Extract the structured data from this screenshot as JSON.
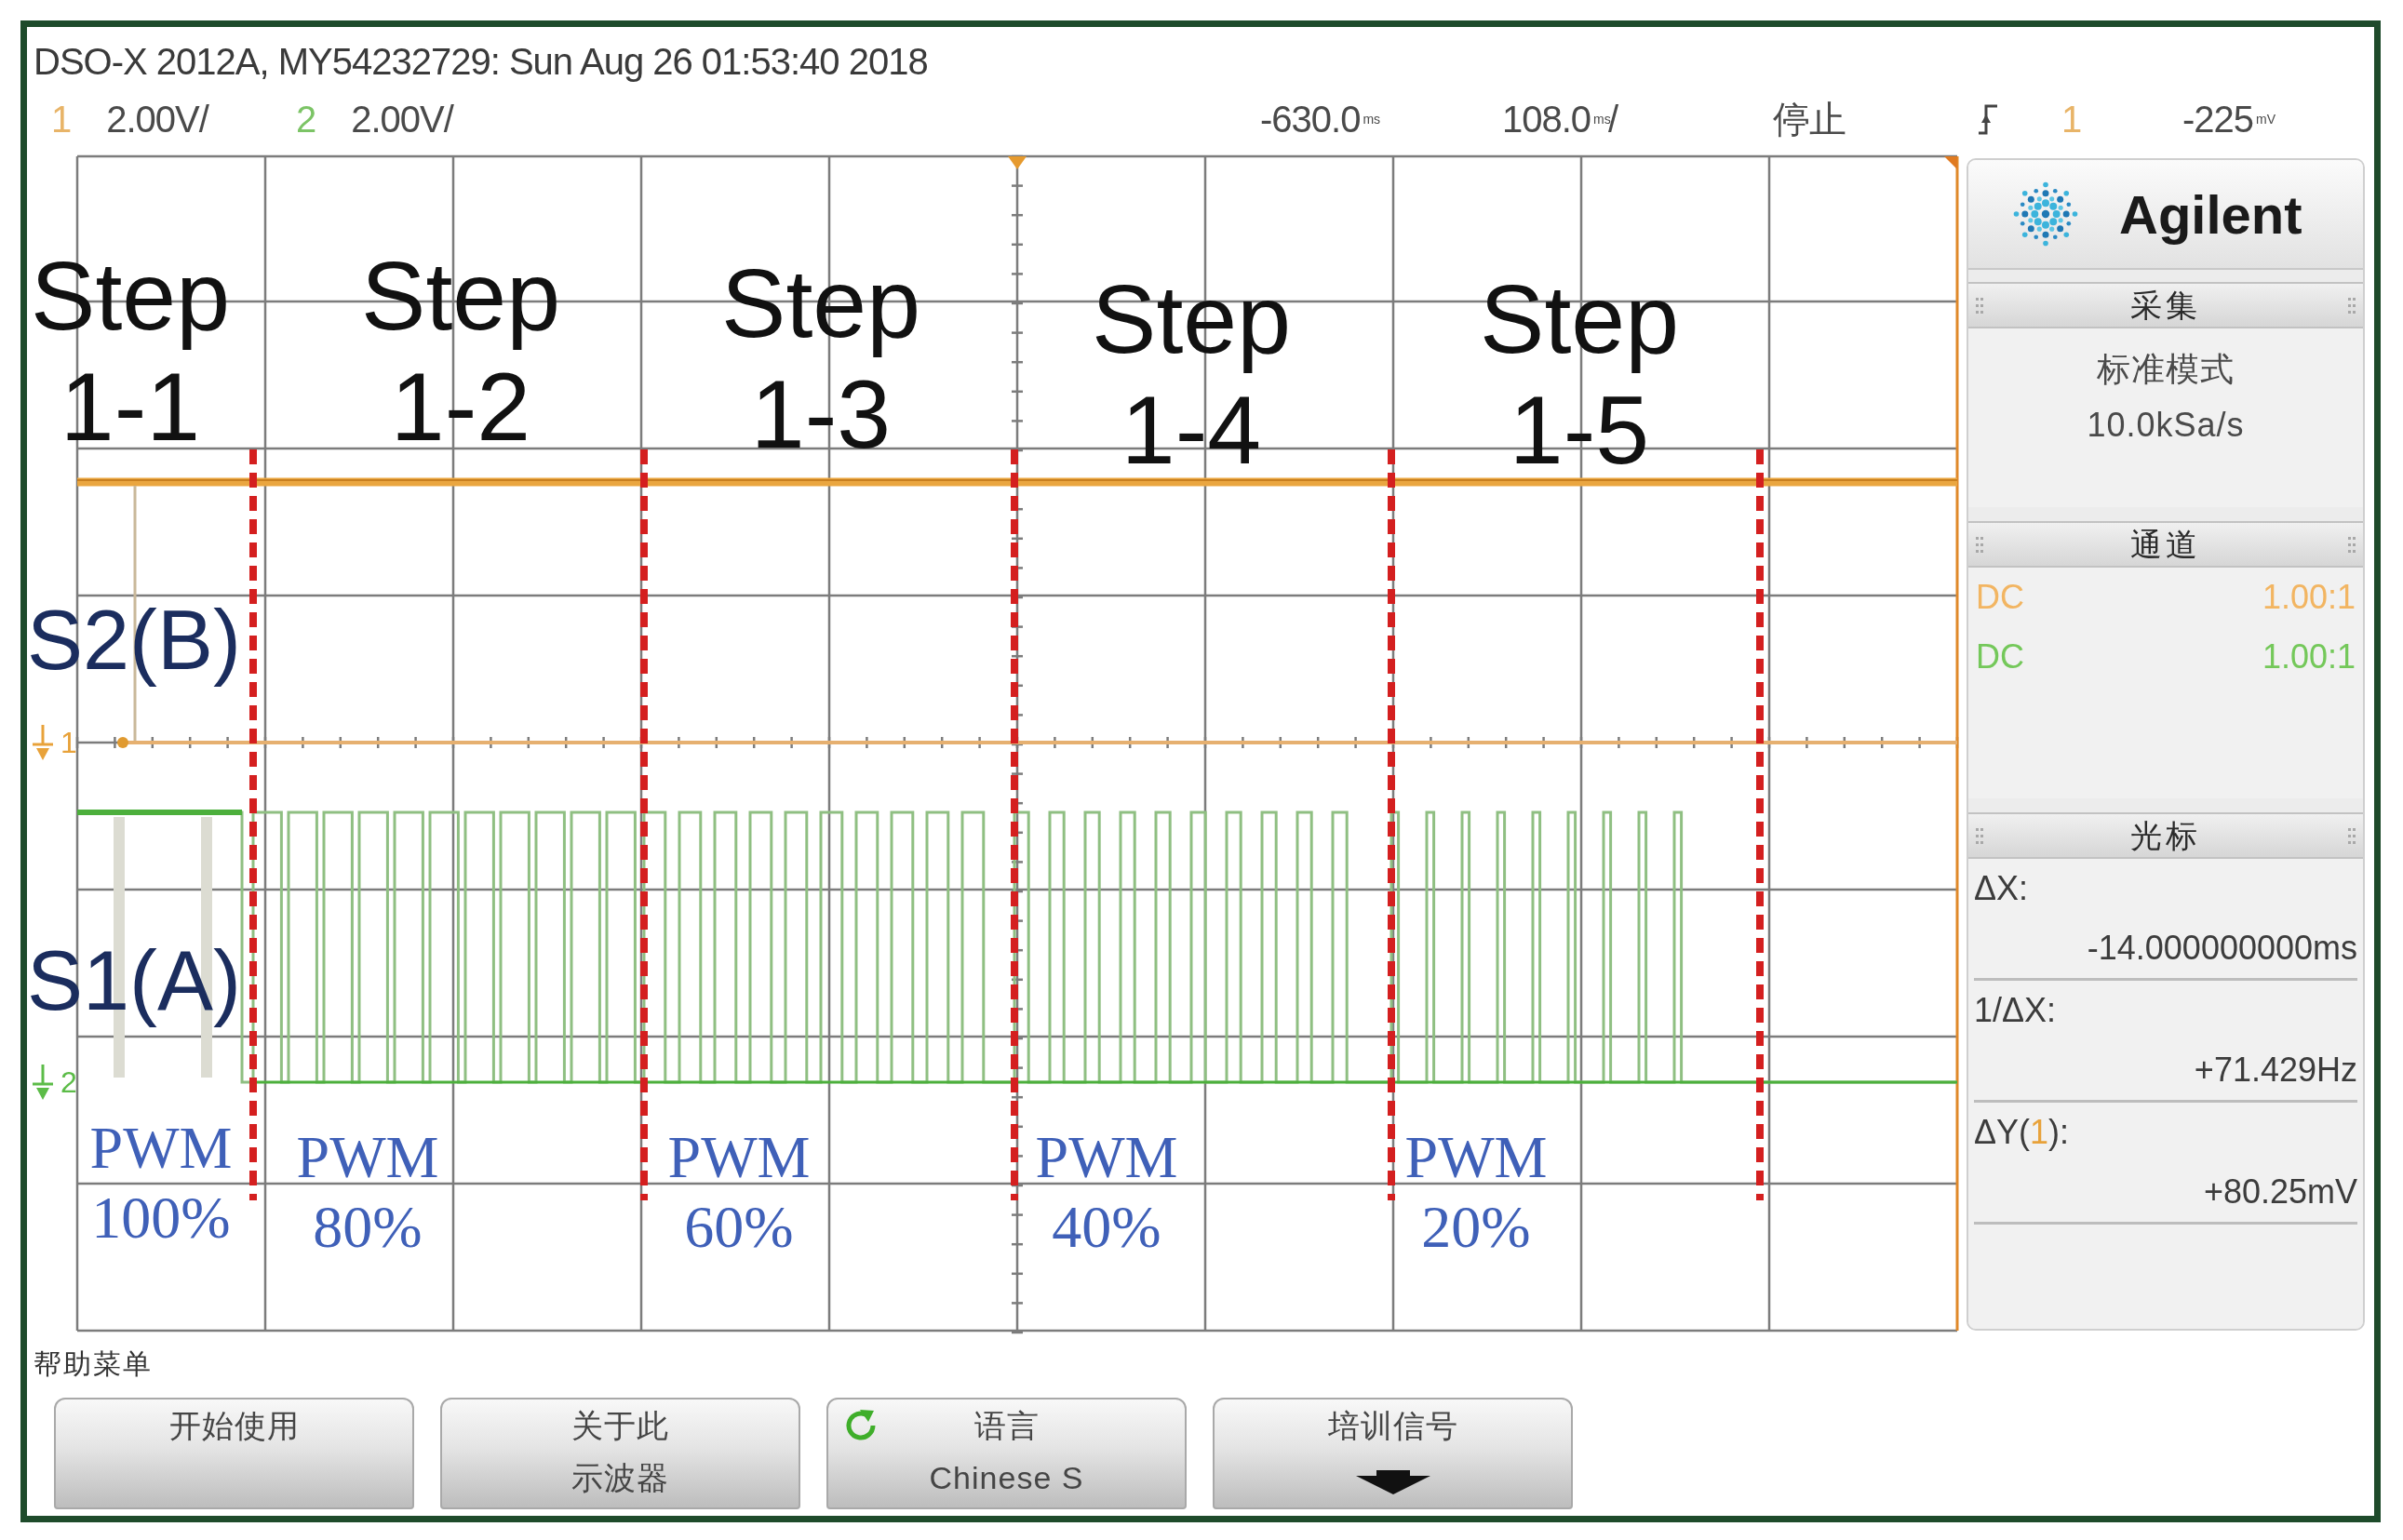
{
  "header": {
    "title": "DSO-X 2012A, MY54232729: Sun Aug 26 01:53:40 2018",
    "channels": [
      {
        "number": "1",
        "scale": "2.00V/",
        "color": "#e8b468"
      },
      {
        "number": "2",
        "scale": "2.00V/",
        "color": "#7cc466"
      }
    ],
    "delay": {
      "value": "-630.0",
      "unit": "ms"
    },
    "timebase": {
      "value": "108.0",
      "unit": "ms",
      "suffix": "/"
    },
    "run_state": "停止",
    "trigger": {
      "source": "1",
      "level": "-225",
      "unit": "mV"
    }
  },
  "scope": {
    "steps": [
      "Step 1-1",
      "Step 1-2",
      "Step 1-3",
      "Step 1-4",
      "Step 1-5"
    ],
    "signals": [
      "S2(B)",
      "S1(A)"
    ],
    "pwm": [
      "PWM 100%",
      "PWM 80%",
      "PWM 60%",
      "PWM 40%",
      "PWM 20%"
    ],
    "markers": [
      {
        "number": "1",
        "color": "#e8a23a"
      },
      {
        "number": "2",
        "color": "#5cbc48"
      }
    ]
  },
  "panel": {
    "brand": "Agilent",
    "acquisition": {
      "title": "采集",
      "mode": "标准模式",
      "rate": "10.0kSa/s"
    },
    "channels": {
      "title": "通道",
      "rows": [
        {
          "coupling": "DC",
          "probe": "1.00:1",
          "color": "#f2b562"
        },
        {
          "coupling": "DC",
          "probe": "1.00:1",
          "color": "#74c85a"
        }
      ]
    },
    "cursors": {
      "title": "光标",
      "readouts": [
        {
          "label": "ΔX:",
          "value": "-14.000000000ms"
        },
        {
          "label": "1/ΔX:",
          "value": "+71.429Hz"
        },
        {
          "label": "ΔY(",
          "channel": "1",
          "label_end": "):",
          "value": "+80.25mV"
        }
      ]
    }
  },
  "menu": {
    "title": "帮助菜单",
    "buttons": [
      {
        "kind": "plain",
        "lines": [
          "开始使用"
        ]
      },
      {
        "kind": "plain",
        "lines": [
          "关于此",
          "示波器"
        ]
      },
      {
        "kind": "cycle",
        "lines": [
          "语言",
          "Chinese S"
        ]
      },
      {
        "kind": "more",
        "lines": [
          "培训信号"
        ]
      }
    ]
  }
}
